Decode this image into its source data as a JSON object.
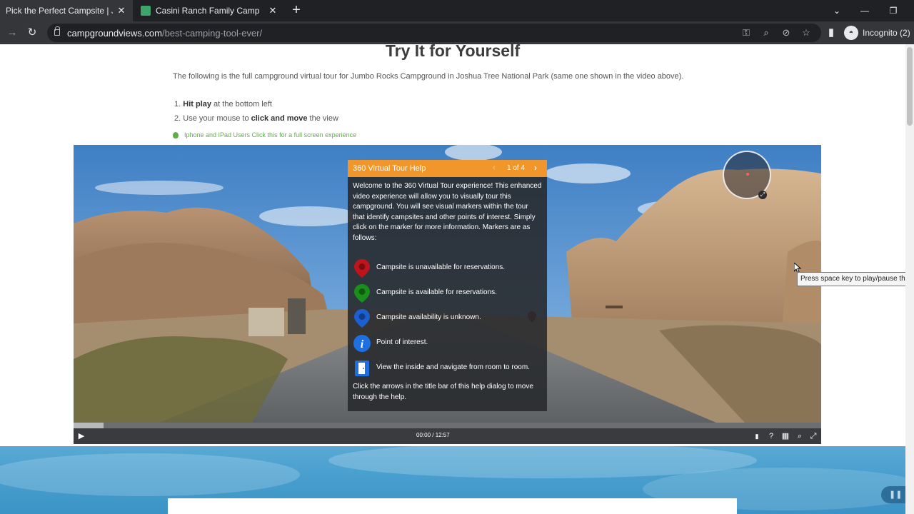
{
  "browser": {
    "tabs": [
      {
        "title": "Pick the Perfect Campsite | Join n",
        "active": true
      },
      {
        "title": "Casini Ranch Family Campground",
        "active": false
      }
    ],
    "url_host": "campgroundviews.com",
    "url_path": "/best-camping-tool-ever/",
    "profile_label": "Incognito (2)"
  },
  "page": {
    "title": "Try It for Yourself",
    "intro_prefix": "The following is the full campground virtual tour for ",
    "intro_link": "Jumbo Rocks Campground in Joshua Tree National Park",
    "intro_suffix": " (same one shown in the video above).",
    "steps": [
      {
        "num": "1.",
        "bold": "Hit play",
        "rest": " at the bottom left"
      },
      {
        "num": "2.",
        "pre": "Use your mouse to ",
        "bold": "click and move",
        "rest": " the view"
      }
    ],
    "iphone_link": "Iphone and IPad Users Click this for a full screen experience"
  },
  "help_dialog": {
    "title": "360 Virtual Tour Help",
    "pager": "1 of 4",
    "intro": "Welcome to the 360 Virtual Tour experience! This enhanced video experience will allow you to visually tour this campground. You will see visual markers within the tour that identify campsites and other points of interest. Simply click on the marker for more information. Markers are as follows:",
    "legend": [
      {
        "icon": "red-marker-icon",
        "text": "Campsite is unavailable for reservations."
      },
      {
        "icon": "green-marker-icon",
        "text": "Campsite is available for reservations."
      },
      {
        "icon": "blue-marker-icon",
        "text": "Campsite availability is unknown."
      },
      {
        "icon": "info-icon",
        "text": "Point of interest."
      },
      {
        "icon": "door-icon",
        "text": "View the inside and navigate from room to room."
      }
    ],
    "footer": "Click the arrows in the title bar of this help dialog to move through the help."
  },
  "player": {
    "time": "00:00 / 12:57",
    "buffered_fraction": 0.04
  },
  "tooltip": "Press space key to play/pause the v",
  "colors": {
    "accent_orange": "#f0962a",
    "marker_red": "#c0141c",
    "marker_green": "#1b8f1b",
    "marker_blue": "#1e5fd0"
  }
}
